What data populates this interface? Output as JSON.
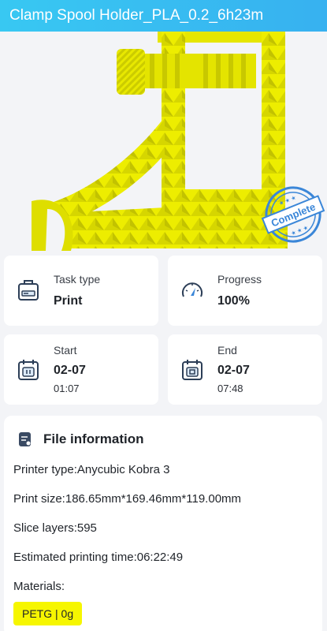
{
  "header": {
    "title": "Clamp Spool Holder_PLA_0.2_6h23m"
  },
  "preview": {
    "stamp_text": "Complete",
    "model_color": "#f0f000",
    "stamp_color": "#3a86d8"
  },
  "task_type": {
    "label": "Task type",
    "value": "Print",
    "icon": "task-type-icon"
  },
  "progress": {
    "label": "Progress",
    "value": "100%",
    "icon": "gauge-icon",
    "percent": 100
  },
  "start": {
    "label": "Start",
    "date": "02-07",
    "time": "01:07",
    "icon": "calendar-pause-icon"
  },
  "end": {
    "label": "End",
    "date": "02-07",
    "time": "07:48",
    "icon": "calendar-stop-icon"
  },
  "file_info": {
    "title": "File information",
    "icon": "document-icon",
    "printer_type": "Printer type:Anycubic Kobra 3",
    "print_size": "Print size:186.65mm*169.46mm*119.00mm",
    "slice_layers": "Slice layers:595",
    "estimated_time": "Estimated printing time:06:22:49",
    "materials_label": "Materials:",
    "materials": [
      "PETG | 0g"
    ]
  },
  "colors": {
    "accent": "#37b1f0",
    "material_chip": "#f6f600"
  }
}
